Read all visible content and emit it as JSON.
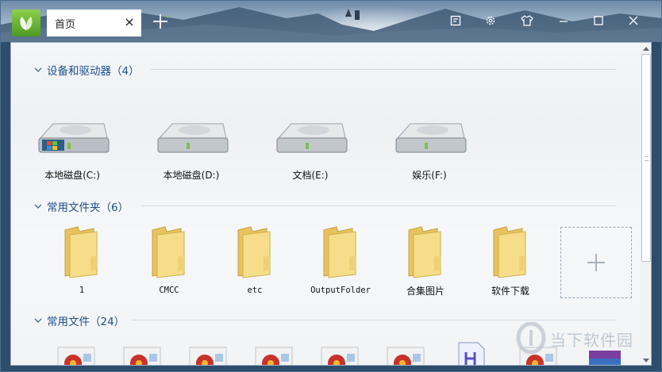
{
  "titlebar": {
    "tab_label": "首页",
    "icons": [
      "app-logo-icon",
      "close-tab-icon",
      "new-tab-icon",
      "skin-editor-icon",
      "settings-icon",
      "theme-shirt-icon",
      "minimize-icon",
      "maximize-icon",
      "close-window-icon"
    ]
  },
  "sections": {
    "drives": {
      "title": "设备和驱动器（4）",
      "items": [
        {
          "label": "本地磁盘(C:)",
          "icon": "system-drive-icon"
        },
        {
          "label": "本地磁盘(D:)",
          "icon": "hard-drive-icon"
        },
        {
          "label": "文档(E:)",
          "icon": "hard-drive-icon"
        },
        {
          "label": "娱乐(F:)",
          "icon": "hard-drive-icon"
        }
      ]
    },
    "folders": {
      "title": "常用文件夹（6）",
      "items": [
        {
          "label": "1",
          "icon": "folder-icon"
        },
        {
          "label": "CMCC",
          "icon": "folder-icon"
        },
        {
          "label": "etc",
          "icon": "folder-icon"
        },
        {
          "label": "OutputFolder",
          "icon": "folder-icon"
        },
        {
          "label": "合集图片",
          "icon": "folder-icon"
        },
        {
          "label": "软件下载",
          "icon": "folder-icon"
        }
      ],
      "add_icon": "plus-icon"
    },
    "files": {
      "title": "常用文件（24）"
    }
  },
  "watermark": {
    "text": "当下软件园"
  },
  "colors": {
    "section_title": "#1d4f8c",
    "logo_green": "#6cb838",
    "folder_yellow": "#f3d57a"
  }
}
